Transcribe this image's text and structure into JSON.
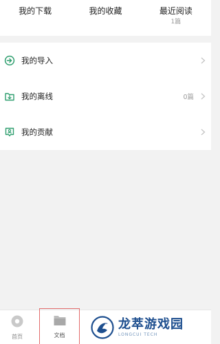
{
  "top_tabs": [
    {
      "label": "我的下载",
      "sub": ""
    },
    {
      "label": "我的收藏",
      "sub": ""
    },
    {
      "label": "最近阅读",
      "sub": "1篇"
    }
  ],
  "list": {
    "items": [
      {
        "label": "我的导入",
        "value": "",
        "icon": "import-icon"
      },
      {
        "label": "我的离线",
        "value": "0篇",
        "icon": "offline-download-icon"
      },
      {
        "label": "我的贡献",
        "value": "",
        "icon": "contribution-icon"
      }
    ]
  },
  "bottom_nav": {
    "items": [
      {
        "label": "首页",
        "icon": "home-icon"
      },
      {
        "label": "文档",
        "icon": "folder-icon"
      }
    ]
  },
  "watermark": {
    "title": "龙萃游戏园",
    "subtitle": "LONGCUI TECH"
  },
  "colors": {
    "accent": "#2e9e6e",
    "highlight_border": "#e26b6b",
    "watermark": "#1e4f8f"
  }
}
